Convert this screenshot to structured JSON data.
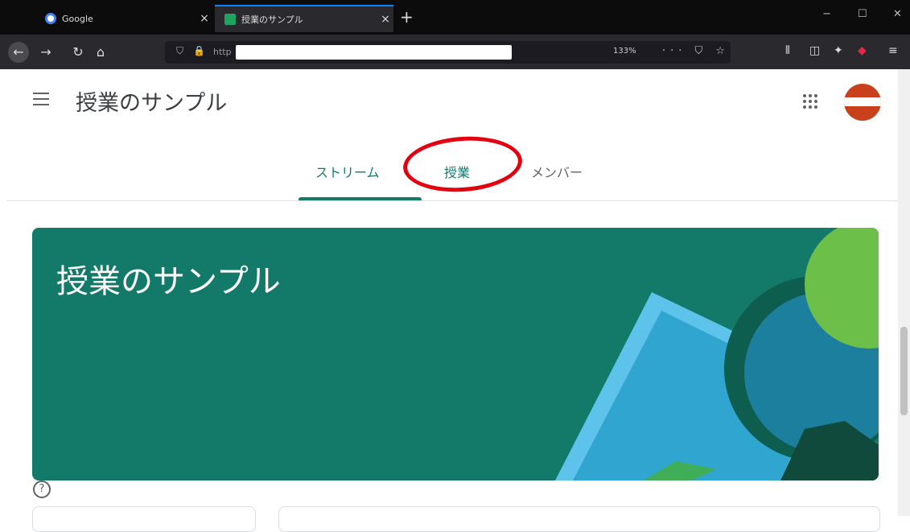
{
  "browser": {
    "tabs": [
      {
        "title": "Google",
        "close": "×"
      },
      {
        "title": "授業のサンプル",
        "close": "×"
      }
    ],
    "new_tab": "+",
    "window_controls": [
      "−",
      "☐",
      "✕"
    ],
    "url_prefix": "http",
    "zoom": "133%",
    "page_actions": "··· ⛉ ☆"
  },
  "header": {
    "title": "授業のサンプル"
  },
  "tabs": [
    {
      "label": "ストリーム",
      "active": true
    },
    {
      "label": "授業",
      "active": false
    },
    {
      "label": "メンバー",
      "active": false
    }
  ],
  "banner": {
    "title": "授業のサンプル"
  },
  "help": "?",
  "colors": {
    "accent": "#137a6a",
    "highlight": "#e3000f"
  }
}
